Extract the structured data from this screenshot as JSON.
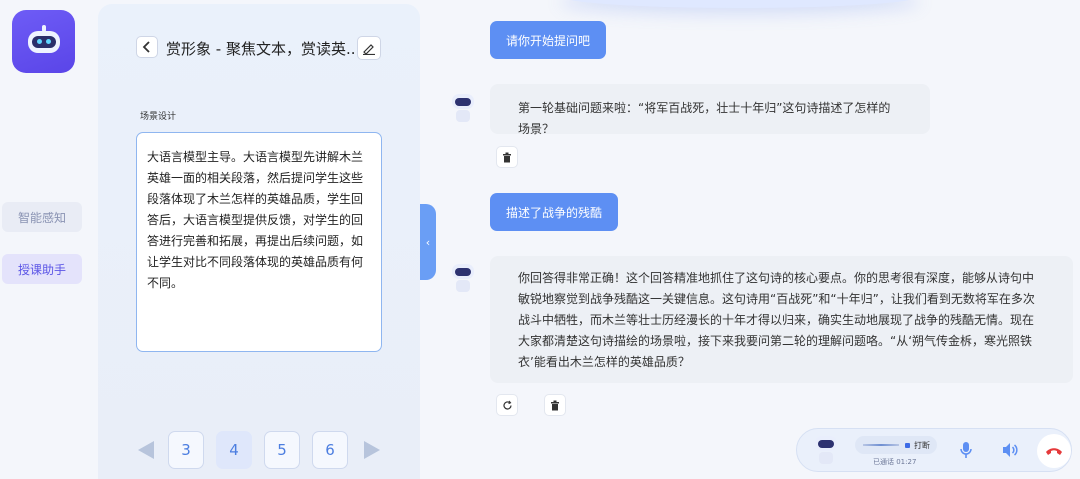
{
  "rail": {
    "smart_label": "智能感知",
    "teach_label": "授课助手"
  },
  "panel": {
    "title": "赏形象 - 聚焦文本，赏读英...",
    "section_label": "场景设计",
    "scene_text": "大语言模型主导。大语言模型先讲解木兰英雄一面的相关段落，然后提问学生这些段落体现了木兰怎样的英雄品质，学生回答后，大语言模型提供反馈，对学生的回答进行完善和拓展，再提出后续问题，如让学生对比不同段落体现的英雄品质有何不同。",
    "pages": [
      "3",
      "4",
      "5",
      "6"
    ],
    "active_page": "4"
  },
  "chat": {
    "user_msg_1": "请你开始提问吧",
    "bot_msg_1": "第一轮基础问题来啦：“将军百战死，壮士十年归”这句诗描述了怎样的场景？",
    "user_msg_2": "描述了战争的残酷",
    "bot_msg_2": "你回答得非常正确！这个回答精准地抓住了这句诗的核心要点。你的思考很有深度，能够从诗句中敏锐地察觉到战争残酷这一关键信息。这句诗用“百战死”和“十年归”，让我们看到无数将军在多次战斗中牺牲，而木兰等壮士历经漫长的十年才得以归来，确实生动地展现了战争的残酷无情。现在大家都清楚这句诗描绘的场景啦，接下来我要问第二轮的理解问题咯。“从‘朔气传金柝，寒光照铁衣’能看出木兰怎样的英雄品质？"
  },
  "callbar": {
    "interrupt_label": "打断",
    "time_label": "已通话 01:27"
  },
  "colors": {
    "accent": "#5d8ff3",
    "brand": "#5a45e8",
    "hangup": "#e5393a"
  }
}
